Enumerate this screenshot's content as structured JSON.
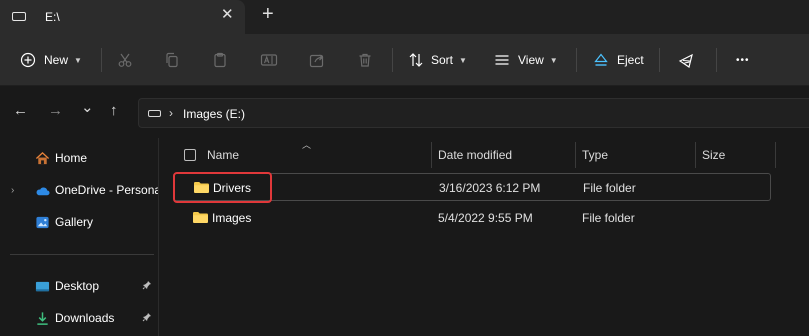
{
  "tab": {
    "title": "E:\\",
    "close_glyph": "✕",
    "new_glyph": "+"
  },
  "toolbar": {
    "new_label": "New",
    "sort_label": "Sort",
    "view_label": "View",
    "eject_label": "Eject",
    "more_glyph": "•••",
    "icons": [
      "plus-circle-icon",
      "cut-icon",
      "copy-icon",
      "paste-icon",
      "rename-icon",
      "share-icon",
      "delete-icon",
      "sort-icon",
      "view-icon",
      "eject-icon",
      "properties-icon",
      "more-icon"
    ]
  },
  "navigation": {
    "back": "←",
    "forward": "→",
    "recent": "⌄",
    "up": "↑"
  },
  "address": {
    "chevron": "›",
    "path": "Images (E:)"
  },
  "sidebar": {
    "items": [
      {
        "label": "Home"
      },
      {
        "label": "OneDrive - Persona"
      },
      {
        "label": "Gallery"
      },
      {
        "label": "Desktop"
      },
      {
        "label": "Downloads"
      }
    ],
    "expand_glyph": "›",
    "pin_glyph": "📌"
  },
  "columns": {
    "name": "Name",
    "date": "Date modified",
    "type": "Type",
    "size": "Size"
  },
  "files": [
    {
      "name": "Drivers",
      "date": "3/16/2023 6:12 PM",
      "type": "File folder",
      "size": ""
    },
    {
      "name": "Images",
      "date": "5/4/2022 9:55 PM",
      "type": "File folder",
      "size": ""
    }
  ],
  "colors": {
    "folder": "#f4c94b",
    "accent": "#4cc2ff",
    "highlight": "#e0383a"
  }
}
